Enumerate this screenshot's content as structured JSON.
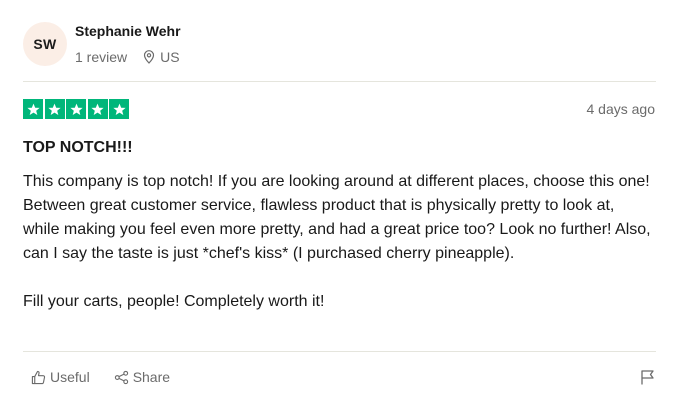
{
  "reviewer": {
    "initials": "SW",
    "name": "Stephanie Wehr",
    "review_count": "1 review",
    "country": "US",
    "avatar_bg": "#fbeee6"
  },
  "rating": {
    "stars": 5,
    "max": 5,
    "color": "#00b67a"
  },
  "date": "4 days ago",
  "review": {
    "title": "TOP NOTCH!!!",
    "paragraph_1": "This company is top notch! If you are looking around at different places, choose this one! Between great customer service, flawless product that is physically pretty to look at, while making you feel even more pretty, and had a great price too? Look no further! Also, can I say the taste is just *chef's kiss* (I purchased cherry pineapple).",
    "paragraph_2": "Fill your carts, people! Completely worth it!"
  },
  "actions": {
    "useful_label": "Useful",
    "share_label": "Share",
    "useful_icon": "thumbs-up-icon",
    "share_icon": "share-icon",
    "flag_icon": "flag-icon"
  }
}
